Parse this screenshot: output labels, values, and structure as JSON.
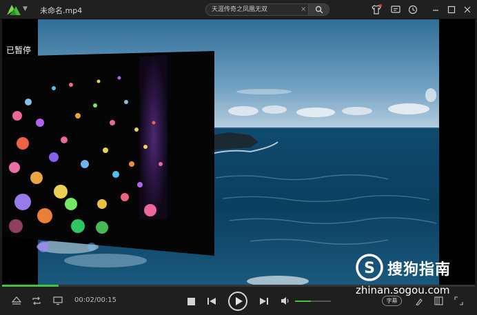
{
  "titlebar": {
    "file_title": "未命名.mp4",
    "search_value": "天涯传奇之凤凰无双",
    "search_clear": "×",
    "icons": [
      "logo-icon",
      "chevron-down-icon",
      "search-icon",
      "tshirt-icon",
      "message-icon",
      "clock-icon",
      "minimize-icon",
      "maximize-icon",
      "close-icon"
    ]
  },
  "video": {
    "status_text": "已暂停"
  },
  "playback": {
    "time_display": "00:02/00:15",
    "progress": 0.12,
    "volume": 0.45,
    "subtitle_label": "字幕"
  },
  "watermark": {
    "name": "搜狗指南",
    "url": "zhinan.sogou.com"
  },
  "colors": {
    "accent": "#47c23f",
    "background": "#1b1b1b",
    "notification": "#e8393a"
  }
}
